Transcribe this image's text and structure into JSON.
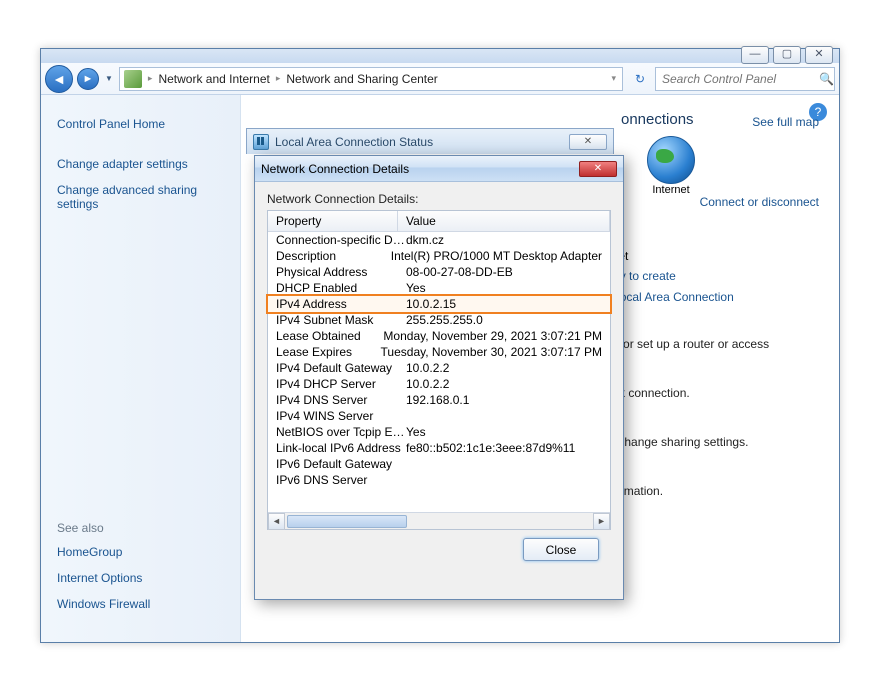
{
  "window": {
    "breadcrumb": {
      "a": "Network and Internet",
      "b": "Network and Sharing Center"
    },
    "search_placeholder": "Search Control Panel"
  },
  "sidebar": {
    "home": "Control Panel Home",
    "adapter": "Change adapter settings",
    "advanced": "Change advanced sharing settings",
    "see_also": "See also",
    "homegroup": "HomeGroup",
    "inetopt": "Internet Options",
    "firewall": "Windows Firewall"
  },
  "main": {
    "heading_partial": "onnections",
    "internet_label": "Internet",
    "see_full_map": "See full map",
    "connect_disconnect": "Connect or disconnect",
    "type_label": ":",
    "type_val": "Internet",
    "ready": "Ready to create",
    "lac": "Local Area Connection",
    "p1": "nnection; or set up a router or access",
    "p2": "N network connection.",
    "p3": "uters, or change sharing settings.",
    "p4": "oting information."
  },
  "status_dialog": {
    "title": "Local Area Connection Status"
  },
  "details_dialog": {
    "title": "Network Connection Details",
    "label": "Network Connection Details:",
    "head_prop": "Property",
    "head_val": "Value",
    "close_btn": "Close",
    "rows": [
      {
        "p": "Connection-specific DN...",
        "v": "dkm.cz"
      },
      {
        "p": "Description",
        "v": "Intel(R) PRO/1000 MT Desktop Adapter"
      },
      {
        "p": "Physical Address",
        "v": "08-00-27-08-DD-EB"
      },
      {
        "p": "DHCP Enabled",
        "v": "Yes"
      },
      {
        "p": "IPv4 Address",
        "v": "10.0.2.15",
        "hl": true
      },
      {
        "p": "IPv4 Subnet Mask",
        "v": "255.255.255.0"
      },
      {
        "p": "Lease Obtained",
        "v": "Monday, November 29, 2021 3:07:21 PM"
      },
      {
        "p": "Lease Expires",
        "v": "Tuesday, November 30, 2021 3:07:17 PM"
      },
      {
        "p": "IPv4 Default Gateway",
        "v": "10.0.2.2"
      },
      {
        "p": "IPv4 DHCP Server",
        "v": "10.0.2.2"
      },
      {
        "p": "IPv4 DNS Server",
        "v": "192.168.0.1"
      },
      {
        "p": "IPv4 WINS Server",
        "v": ""
      },
      {
        "p": "NetBIOS over Tcpip En...",
        "v": "Yes"
      },
      {
        "p": "Link-local IPv6 Address",
        "v": "fe80::b502:1c1e:3eee:87d9%11"
      },
      {
        "p": "IPv6 Default Gateway",
        "v": ""
      },
      {
        "p": "IPv6 DNS Server",
        "v": ""
      }
    ],
    "highlight_color": "#f08020"
  }
}
